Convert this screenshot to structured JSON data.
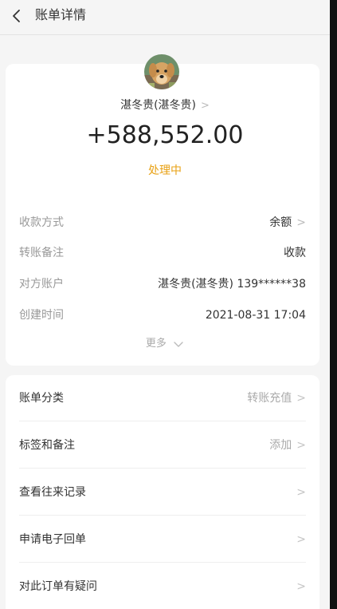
{
  "header": {
    "title": "账单详情"
  },
  "card": {
    "name": "湛冬贵(湛冬贵)",
    "amount": "+588,552.00",
    "status": "处理中",
    "info": [
      {
        "label": "收款方式",
        "value": "余额"
      },
      {
        "label": "转账备注",
        "value": "收款"
      },
      {
        "label": "对方账户",
        "value": "湛冬贵(湛冬贵) 139******38"
      },
      {
        "label": "创建时间",
        "value": "2021-08-31 17:04"
      }
    ],
    "more": "更多"
  },
  "list": [
    {
      "label": "账单分类",
      "value": "转账充值"
    },
    {
      "label": "标签和备注",
      "value": "添加"
    },
    {
      "label": "查看往来记录",
      "value": ""
    },
    {
      "label": "申请电子回单",
      "value": ""
    },
    {
      "label": "对此订单有疑问",
      "value": ""
    }
  ],
  "colors": {
    "status": "#e8a114",
    "background": "#f5f5f5",
    "card": "#ffffff"
  },
  "icons": {
    "back": "back-arrow-icon",
    "chevron": "chevron-right-icon",
    "chevron_down": "chevron-down-icon"
  }
}
